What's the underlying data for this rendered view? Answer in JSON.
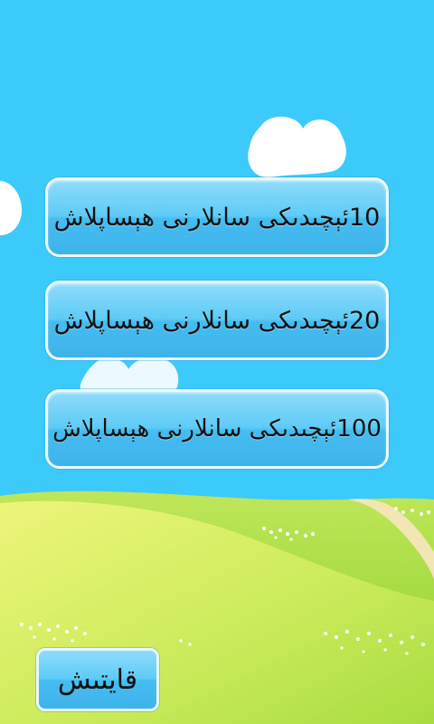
{
  "menu": {
    "buttons": [
      {
        "label": "10ئېچىدىكى سانلارنى ھېساپلاش"
      },
      {
        "label": "20ئېچىدىكى سانلارنى ھېساپلاش"
      },
      {
        "label": "100ئېچىدىكى سانلارنى ھېساپلاش"
      }
    ]
  },
  "footer": {
    "exit_label": "قايتىش"
  },
  "colors": {
    "sky": "#3ccafb",
    "grass": "#a6dc3c",
    "button": "#5ecbf6",
    "button_border": "#e9f8ff"
  }
}
